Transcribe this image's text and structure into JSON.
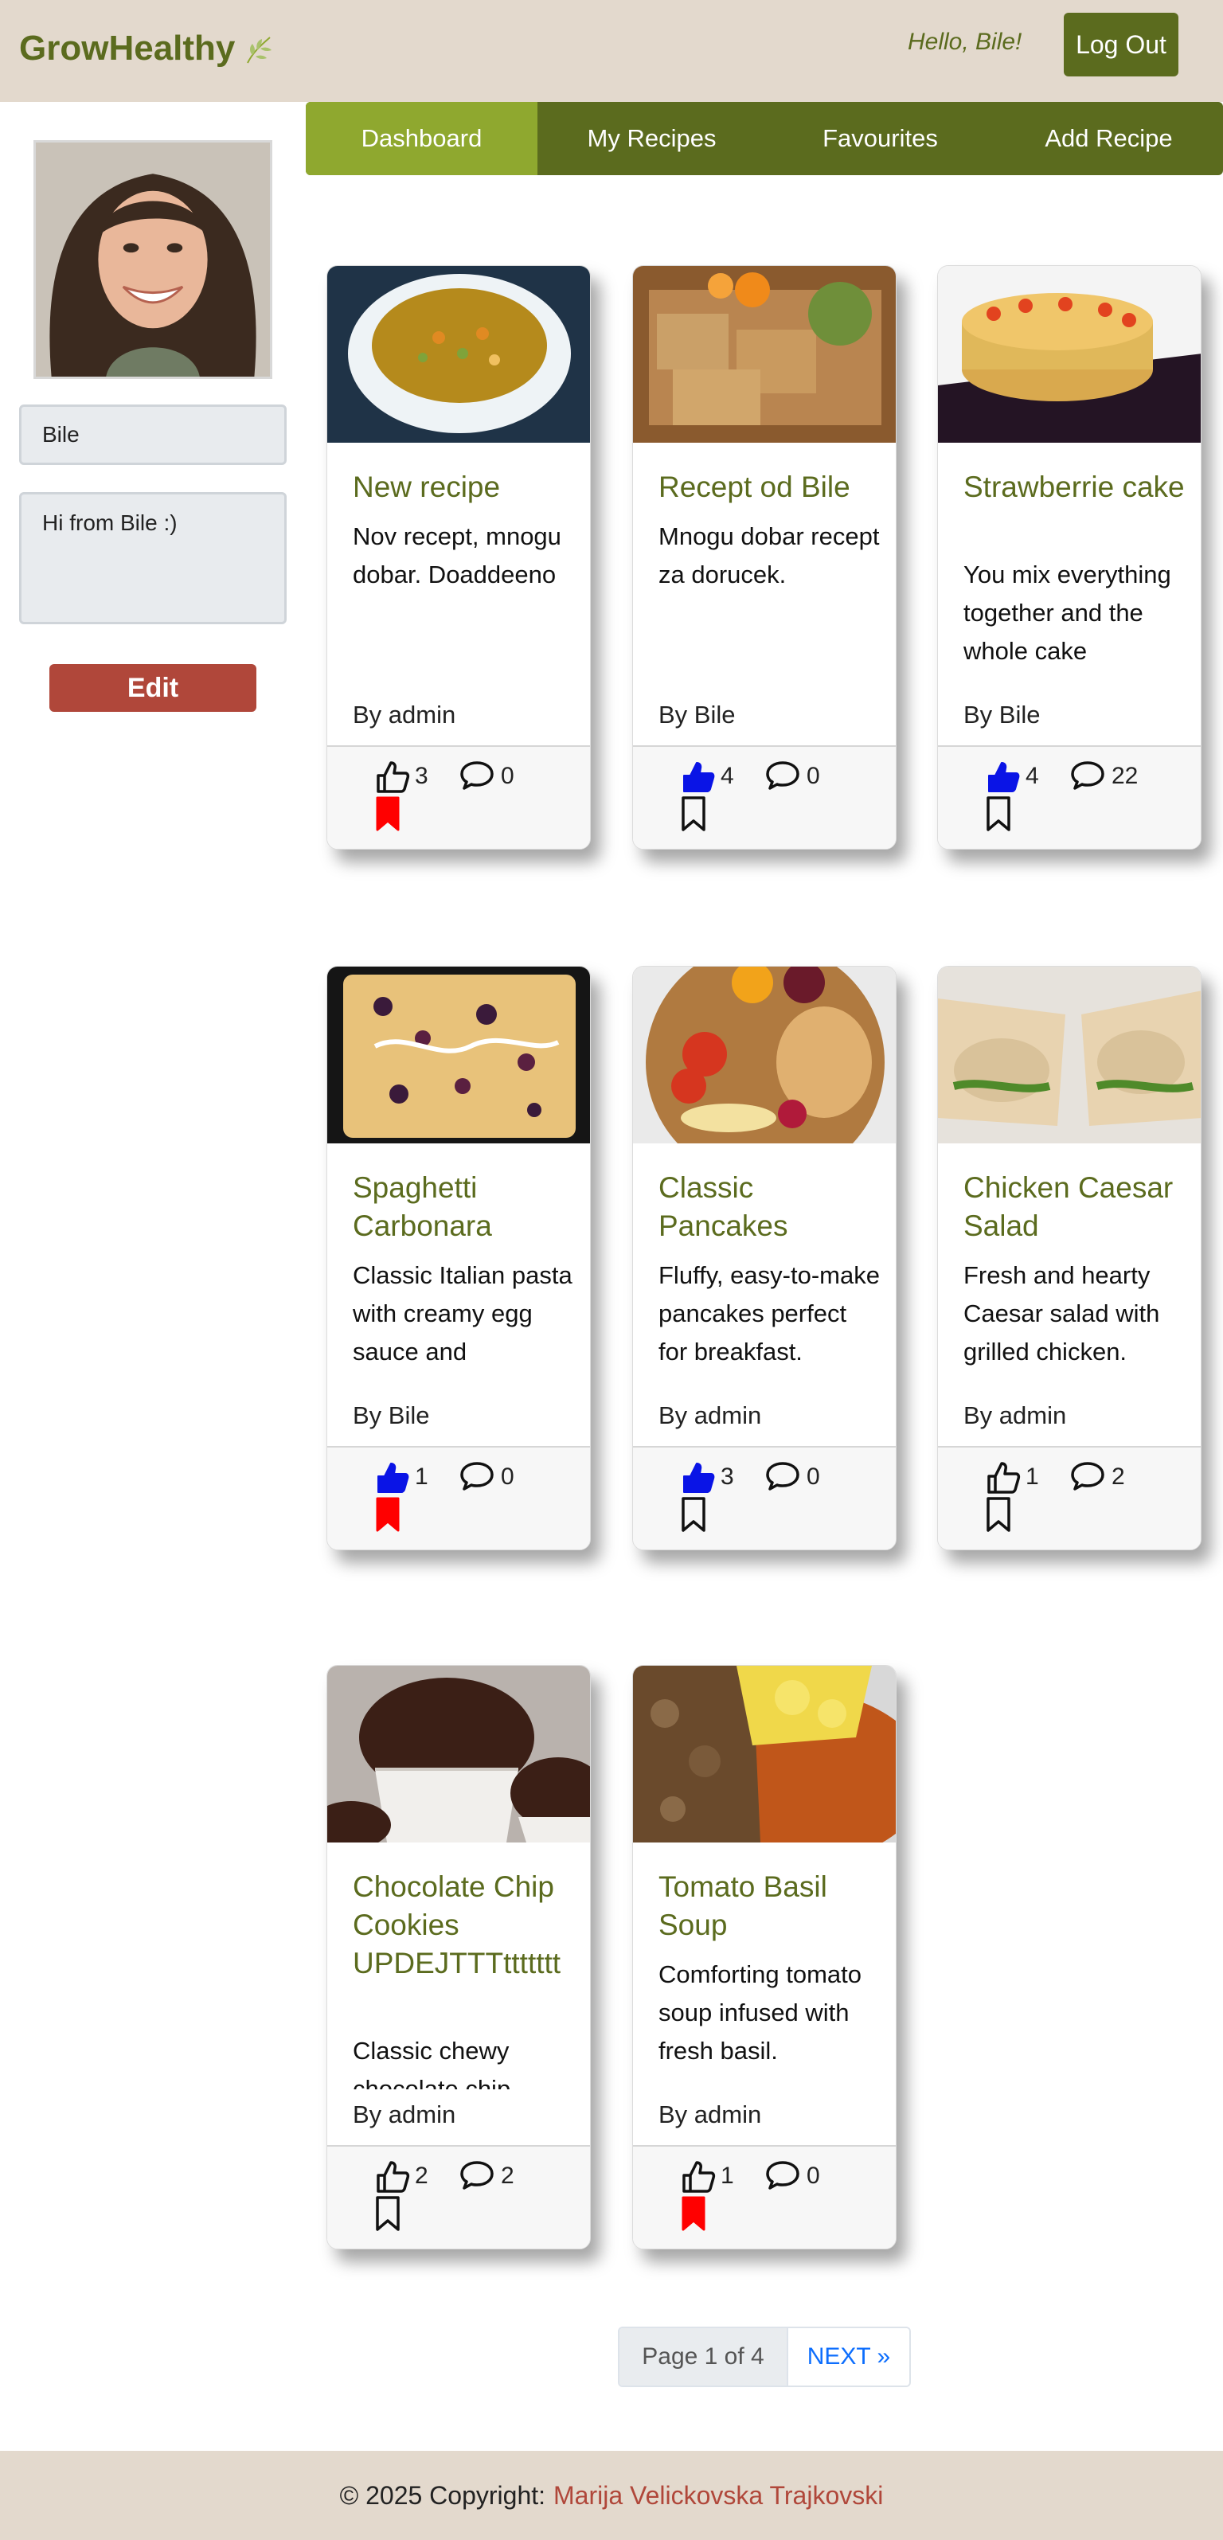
{
  "header": {
    "logo_text": "GrowHealthy",
    "logo_icon": "leaf-icon",
    "greeting": "Hello, Bile!",
    "logout_label": "Log Out"
  },
  "nav": {
    "items": [
      "Dashboard",
      "My Recipes",
      "Favourites",
      "Add Recipe"
    ],
    "active": "Dashboard"
  },
  "profile": {
    "name": "Bile",
    "bio": "Hi from Bile :)",
    "edit_label": "Edit"
  },
  "recipes": [
    {
      "title": "New recipe",
      "description": "Nov recept, mnogu dobar. Doaddeeno",
      "author": "By admin",
      "likes": "3",
      "comments": "0",
      "liked": false,
      "bookmarked": true
    },
    {
      "title": "Recept od Bile",
      "description": "Mnogu dobar recept za dorucek.",
      "author": "By Bile",
      "likes": "4",
      "comments": "0",
      "liked": true,
      "bookmarked": false
    },
    {
      "title": "Strawberrie cake",
      "description": "You mix everything together and the whole cake",
      "author": "By Bile",
      "likes": "4",
      "comments": "22",
      "liked": true,
      "bookmarked": false
    },
    {
      "title": "Spaghetti Carbonara",
      "description": "Classic Italian pasta with creamy egg sauce and",
      "author": "By Bile",
      "likes": "1",
      "comments": "0",
      "liked": true,
      "bookmarked": true
    },
    {
      "title": "Classic Pancakes",
      "description": "Fluffy, easy-to-make pancakes perfect for breakfast.",
      "author": "By admin",
      "likes": "3",
      "comments": "0",
      "liked": true,
      "bookmarked": false
    },
    {
      "title": "Chicken Caesar Salad",
      "description": "Fresh and hearty Caesar salad with grilled chicken.",
      "author": "By admin",
      "likes": "1",
      "comments": "2",
      "liked": false,
      "bookmarked": false
    },
    {
      "title": "Chocolate Chip Cookies UPDEJTTTttttttt",
      "description": "Classic chewy chocolate chip",
      "author": "By admin",
      "likes": "2",
      "comments": "2",
      "liked": false,
      "bookmarked": false
    },
    {
      "title": "Tomato Basil Soup",
      "description": "Comforting tomato soup infused with fresh basil.",
      "author": "By admin",
      "likes": "1",
      "comments": "0",
      "liked": false,
      "bookmarked": true
    }
  ],
  "pagination": {
    "info": "Page 1 of 4",
    "next_label": "NEXT »"
  },
  "footer": {
    "prefix": "© 2025 Copyright:",
    "author": "Marija Velickovska Trajkovski"
  },
  "colors": {
    "brand_green": "#5b6b1e",
    "nav_active": "#8fa82f",
    "edit_red": "#b0473a",
    "liked_blue": "#0a14e6",
    "bookmark_red": "#ff0000",
    "header_bg": "#e3d9cd"
  }
}
